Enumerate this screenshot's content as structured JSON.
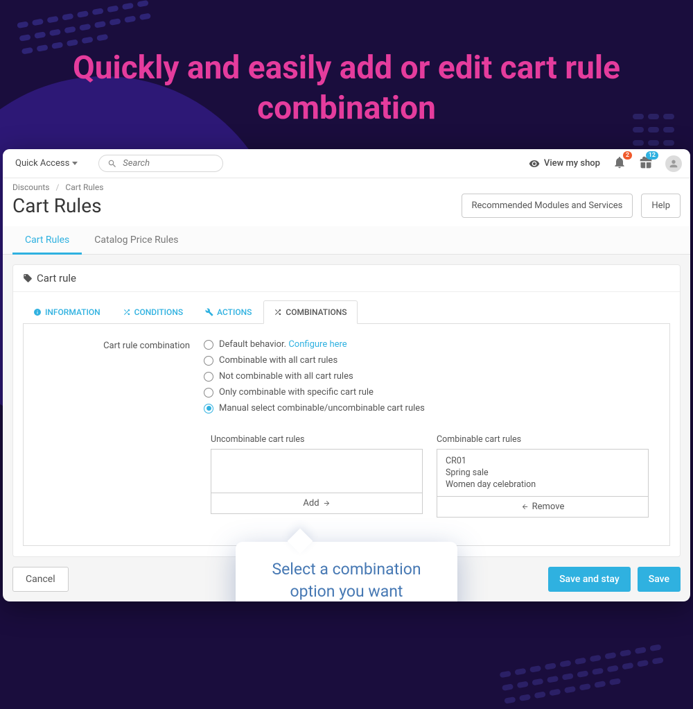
{
  "promo": {
    "heading": "Quickly and easily add or edit cart rule combination"
  },
  "topbar": {
    "quick_access": "Quick Access",
    "search_placeholder": "Search",
    "view_shop": "View my shop",
    "notif_count": "2",
    "cart_count": "12"
  },
  "breadcrumb": {
    "parent": "Discounts",
    "current": "Cart Rules"
  },
  "page": {
    "title": "Cart Rules",
    "recommend_btn": "Recommended Modules and Services",
    "help_btn": "Help"
  },
  "subtabs": {
    "cart_rules": "Cart Rules",
    "catalog_rules": "Catalog Price Rules"
  },
  "panel": {
    "header": "Cart rule"
  },
  "inner_tabs": {
    "information": "INFORMATION",
    "conditions": "CONDITIONS",
    "actions": "ACTIONS",
    "combinations": "COMBINATIONS"
  },
  "form": {
    "field_label": "Cart rule combination",
    "options": {
      "default_prefix": "Default behavior.",
      "default_link": "Configure here",
      "all": "Combinable with all cart rules",
      "none": "Not combinable with all cart rules",
      "specific": "Only combinable with specific cart rule",
      "manual": "Manual select combinable/uncombinable cart rules"
    },
    "uncombinable_label": "Uncombinable cart rules",
    "combinable_label": "Combinable cart rules",
    "combinable_items": [
      "CR01",
      "Spring sale",
      "Women day celebration"
    ],
    "add_btn": "Add",
    "remove_btn": "Remove"
  },
  "footer": {
    "cancel": "Cancel",
    "save_stay": "Save and stay",
    "save": "Save"
  },
  "callout": {
    "text": "Select a combination option you want"
  }
}
